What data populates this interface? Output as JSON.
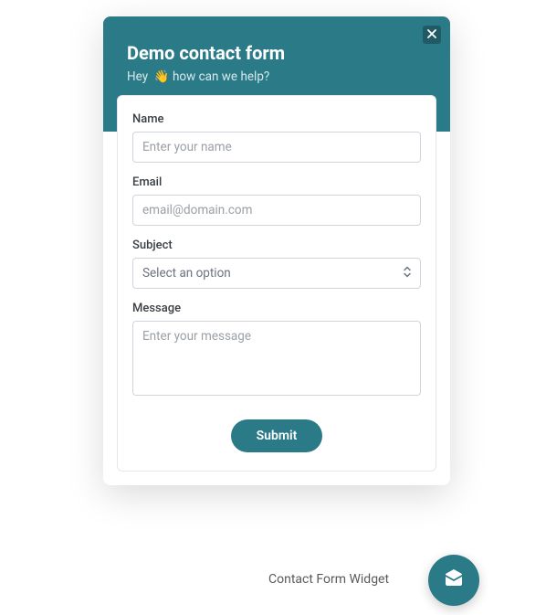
{
  "header": {
    "title": "Demo contact form",
    "subtitle": "Hey  👋 how can we help?"
  },
  "form": {
    "name": {
      "label": "Name",
      "placeholder": "Enter your name",
      "value": ""
    },
    "email": {
      "label": "Email",
      "placeholder": "email@domain.com",
      "value": ""
    },
    "subject": {
      "label": "Subject",
      "placeholder": "Select an option",
      "value": ""
    },
    "message": {
      "label": "Message",
      "placeholder": "Enter your message",
      "value": ""
    },
    "submit_label": "Submit"
  },
  "widget": {
    "label": "Contact Form Widget"
  }
}
